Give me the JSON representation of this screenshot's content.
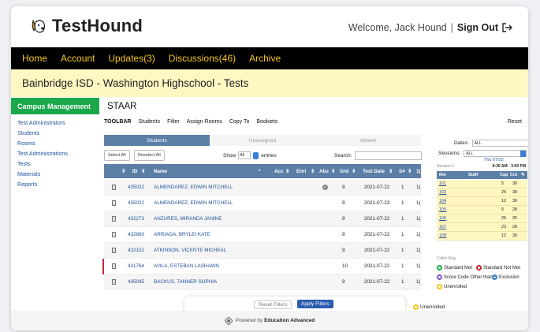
{
  "brand": {
    "name": "TestHound"
  },
  "header": {
    "welcome": "Welcome, Jack Hound",
    "separator": "|",
    "signout": "Sign Out"
  },
  "nav": {
    "items": [
      "Home",
      "Account",
      "Updates(3)",
      "Discussions(46)",
      "Archive"
    ]
  },
  "district_title": "Bainbridge ISD - Washington Highschool - Tests",
  "sidebar": {
    "section": "Campus Management",
    "items": [
      "Test Administrators",
      "Students",
      "Rooms",
      "Test Administrations",
      "Tests",
      "Materials",
      "Reports"
    ]
  },
  "main": {
    "title": "STAAR",
    "toolbar": {
      "label": "TOOLBAR",
      "items": [
        "Students",
        "Filter",
        "Assign Rooms",
        "Copy To",
        "Bookiets"
      ],
      "reset": "Reset"
    },
    "tabs": [
      "Students",
      "Unassigned",
      "Absent"
    ],
    "controls": {
      "select_all": "Select All",
      "deselect_all": "Deselect All",
      "show": "Show",
      "show_value": "All",
      "entries": "entries",
      "search": "Search:"
    },
    "columns": [
      "ID",
      "Name",
      "*",
      "Acc",
      "Enrl",
      "Abs",
      "Grd",
      "Test Date",
      "S#",
      "1("
    ],
    "rows": [
      {
        "id": "435022",
        "name": "ALMENDAREZ, EDWIN MITCHELL",
        "abs": true,
        "grd": "9",
        "date": "2021-07-22",
        "s": "1",
        "extra": "1("
      },
      {
        "id": "435022",
        "name": "ALMENDAREZ, EDWIN MITCHELL",
        "abs": false,
        "grd": "9",
        "date": "2021-07-23",
        "s": "1",
        "extra": "1("
      },
      {
        "id": "432273",
        "name": "ANZURES, MIRANDA JANINE",
        "abs": false,
        "grd": "9",
        "date": "2021-07-22",
        "s": "1",
        "extra": "1("
      },
      {
        "id": "432860",
        "name": "ARRIAGA, BRYLEI KATE",
        "abs": false,
        "grd": "9",
        "date": "2021-07-22",
        "s": "1",
        "extra": "1("
      },
      {
        "id": "432152",
        "name": "ATKINSON, VICENTE MICHEAL",
        "abs": false,
        "grd": "9",
        "date": "2021-07-22",
        "s": "1",
        "extra": "1("
      },
      {
        "id": "431764",
        "name": "AVILA, ESTEBAN LASHAWN",
        "abs": false,
        "grd": "10",
        "date": "2021-07-22",
        "s": "1",
        "extra": "1("
      },
      {
        "id": "435095",
        "name": "BACKUS, TANNER SOPHIA",
        "abs": false,
        "grd": "9",
        "date": "2021-07-22",
        "s": "1",
        "extra": "1("
      }
    ]
  },
  "right_panel": {
    "dates_label": "Dates:",
    "dates_value": "ALL",
    "sessions_label": "Sessions:",
    "sessions_value": "ALL",
    "session_date": "Thu 07/22",
    "session_name": "Session 1",
    "session_time": "8:30 AM - 3:00 PM",
    "room_cols": [
      "Rm",
      "Staff",
      "Cap",
      "Cnt"
    ],
    "rooms": [
      {
        "rm": "101",
        "cap": "5",
        "cnt": "30"
      },
      {
        "rm": "102",
        "cap": "25",
        "cnt": "30"
      },
      {
        "rm": "104",
        "cap": "12",
        "cnt": "30"
      },
      {
        "rm": "105",
        "cap": "5",
        "cnt": "28"
      },
      {
        "rm": "106",
        "cap": "25",
        "cnt": "25"
      },
      {
        "rm": "107",
        "cap": "23",
        "cnt": "28"
      },
      {
        "rm": "108",
        "cap": "12",
        "cnt": "30"
      }
    ],
    "color_key_title": "Color Key",
    "color_key": [
      {
        "label": "Standard Met",
        "color": "#1aa84a"
      },
      {
        "label": "Standard Not Met",
        "color": "#c0262c"
      },
      {
        "label": "Score Code Other than S",
        "color": "#8a4fc9"
      },
      {
        "label": "Exclusion",
        "color": "#3b7fd6"
      },
      {
        "label": "Unenrolled",
        "color": "#f5c518"
      }
    ]
  },
  "popup": {
    "reset_filters": "Reset Filters",
    "apply_filters": "Apply Filters",
    "unenrolled": "Unenrolled"
  },
  "footer": {
    "powered_by": "Powered by",
    "company": "Education Advanced"
  }
}
